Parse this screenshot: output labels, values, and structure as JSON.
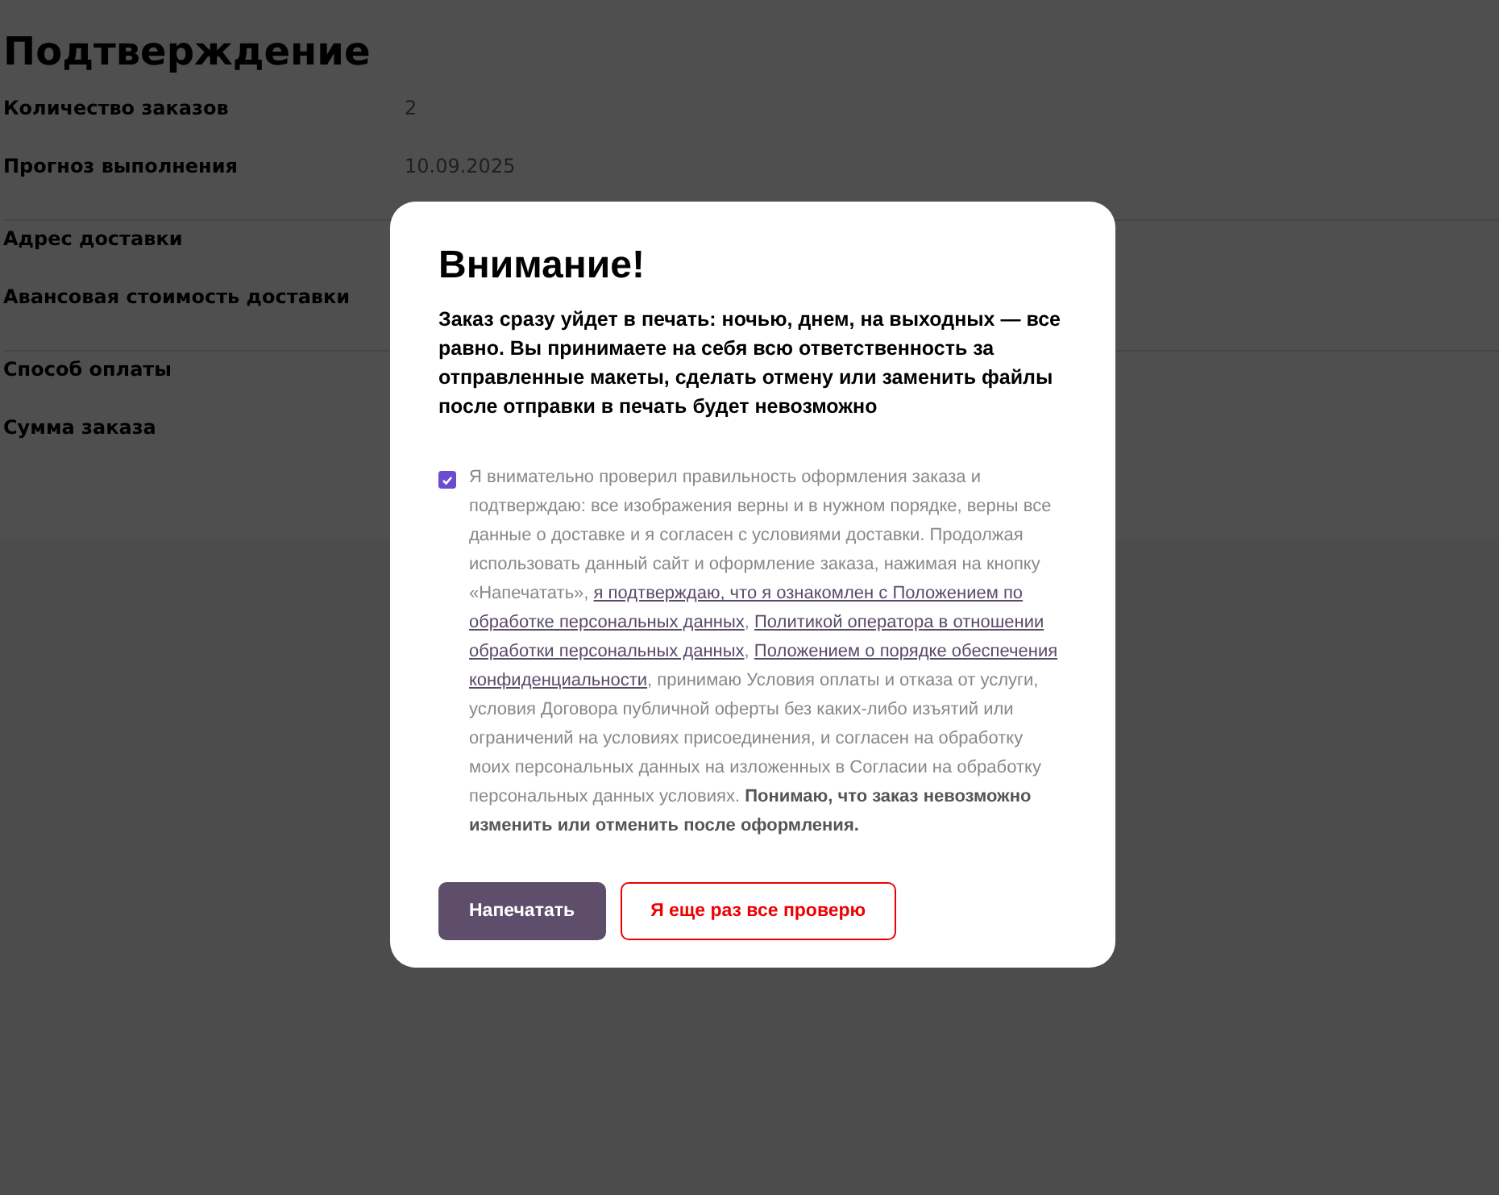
{
  "page": {
    "title": "Подтверждение",
    "groups": [
      {
        "rows": [
          {
            "label": "Количество заказов",
            "value": "2"
          },
          {
            "label": "Прогноз выполнения",
            "value": "10.09.2025"
          }
        ]
      },
      {
        "rows": [
          {
            "label": "Адрес доставки"
          },
          {
            "label": "Авансовая стоимость доставки"
          }
        ]
      },
      {
        "rows": [
          {
            "label": "Способ оплаты"
          },
          {
            "label": "Сумма заказа"
          }
        ]
      }
    ]
  },
  "dialog": {
    "title": "Внимание!",
    "warning": "Заказ сразу уйдет в печать: ночью, днем, на выходных — все равно. Вы принимаете на себя всю ответственность за отправленные макеты, сделать отмену или заменить файлы после отправки в печать будет невозможно",
    "consent": {
      "checked": true,
      "parts": [
        {
          "kind": "text",
          "text": "Я внимательно проверил правильность оформления заказа и подтверждаю: все изображения верны и в нужном порядке, верны все данные о доставке и я согласен с условиями доставки. Продолжая использовать данный сайт и оформление заказа, нажимая на кнопку «Напечатать», "
        },
        {
          "kind": "link",
          "text": "я подтверждаю, что я ознакомлен с Положением по"
        },
        {
          "kind": "link",
          "text": "обработке персональных данных"
        },
        {
          "kind": "text",
          "text": ", "
        },
        {
          "kind": "link",
          "text": "Политикой оператора в отношении"
        },
        {
          "kind": "link",
          "text": "обработки персональных данных"
        },
        {
          "kind": "text",
          "text": ", "
        },
        {
          "kind": "link",
          "text": "Положением о порядке обеспечения"
        },
        {
          "kind": "link",
          "text": "конфиденциальности"
        },
        {
          "kind": "text",
          "text": ", принимаю Условия оплаты и отказа от услуги, условия Договора публичной оферты без каких-либо изъятий или ограничений на условиях присоединения, и согласен на обработку моих персональных данных на изложенных в Согласии на обработку персональных данных условиях. "
        },
        {
          "kind": "bold",
          "text": "Понимаю, что заказ невозможно изменить или отменить после оформления."
        }
      ]
    },
    "buttons": [
      {
        "kind": "primary",
        "label": "Напечатать"
      },
      {
        "kind": "outline",
        "label": "Я еще раз все проверю"
      }
    ]
  }
}
